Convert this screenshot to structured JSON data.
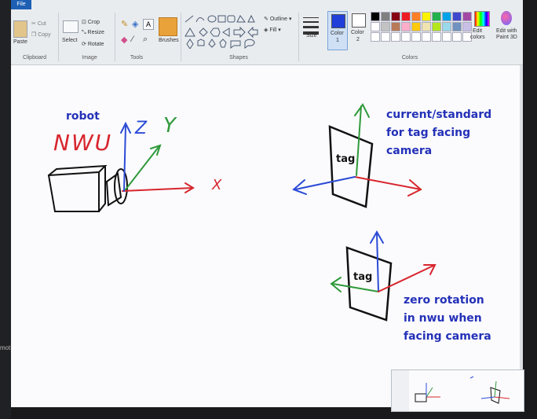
{
  "ribbon": {
    "file_tab": "File",
    "clipboard": {
      "paste": "Paste",
      "cut": "Cut",
      "copy": "Copy",
      "label": "Clipboard"
    },
    "image": {
      "select": "Select",
      "crop": "Crop",
      "resize": "Resize",
      "rotate": "Rotate",
      "label": "Image"
    },
    "tools": {
      "label": "Tools",
      "brushes": "Brushes"
    },
    "shapes": {
      "outline": "Outline",
      "fill": "Fill",
      "label": "Shapes"
    },
    "size": {
      "label": "Size"
    },
    "color1": {
      "line1": "Color",
      "line2": "1"
    },
    "color2": {
      "line1": "Color",
      "line2": "2"
    },
    "edit_colors": {
      "line1": "Edit",
      "line2": "colors"
    },
    "edit_paint3d": {
      "line1": "Edit with",
      "line2": "Paint 3D"
    },
    "colors_label": "Colors",
    "palette_row1": [
      "#000000",
      "#7f7f7f",
      "#880015",
      "#ed1c24",
      "#ff7f27",
      "#fff200",
      "#22b14c",
      "#00a2e8",
      "#3f48cc",
      "#a349a4"
    ],
    "palette_row2": [
      "#ffffff",
      "#c3c3c3",
      "#b97a57",
      "#ffaec9",
      "#ffc90e",
      "#efe4b0",
      "#b5e61d",
      "#99d9ea",
      "#7092be",
      "#c8bfe7"
    ]
  },
  "canvas": {
    "robot_label": "robot",
    "nwu_label": "NWU",
    "z_label": "Z",
    "y_label": "Y",
    "x_label": "X",
    "tag_label_top": "tag",
    "tag_label_bottom": "tag",
    "note_top": [
      "current/standard",
      "for tag facing",
      "camera"
    ],
    "note_bottom": [
      "zero rotation",
      "in nwu when",
      "facing camera"
    ]
  },
  "side_text": "mot",
  "colors": {
    "blue_text": "#2431b8",
    "red_axis": "#d8262e",
    "green_axis": "#2f9a3a",
    "blue_axis": "#2c4bd6"
  }
}
